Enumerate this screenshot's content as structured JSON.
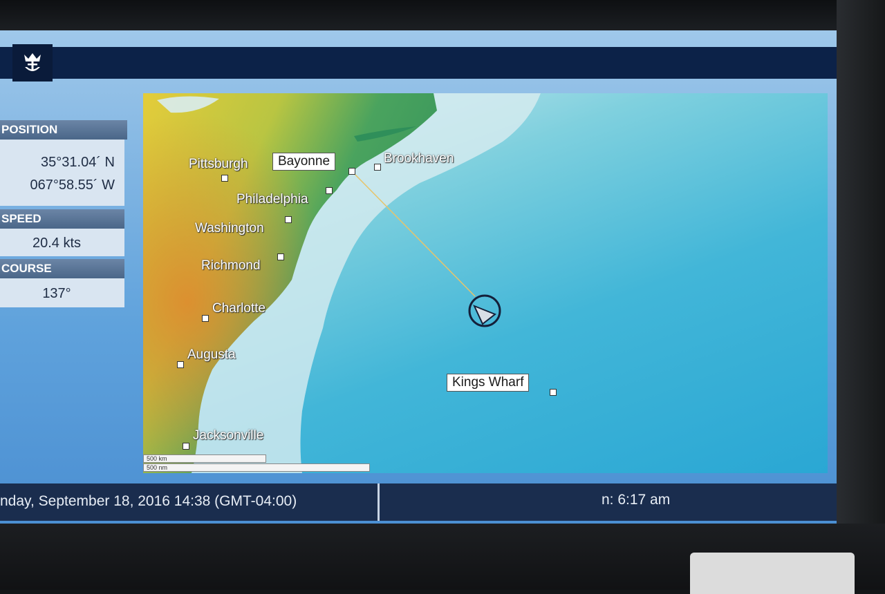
{
  "position": {
    "label": "POSITION",
    "latitude": "35°31.04´ N",
    "longitude": "067°58.55´ W"
  },
  "speed": {
    "label": "SPEED",
    "value": "20.4 kts"
  },
  "course": {
    "label": "COURSE",
    "value": "137°"
  },
  "map": {
    "cities": [
      {
        "name": "Pittsburgh",
        "style": "plain"
      },
      {
        "name": "Bayonne",
        "style": "boxed"
      },
      {
        "name": "Brookhaven",
        "style": "plain"
      },
      {
        "name": "Philadelphia",
        "style": "plain"
      },
      {
        "name": "Washington",
        "style": "plain"
      },
      {
        "name": "Richmond",
        "style": "plain"
      },
      {
        "name": "Charlotte",
        "style": "plain"
      },
      {
        "name": "Augusta",
        "style": "plain"
      },
      {
        "name": "Jacksonville",
        "style": "plain"
      },
      {
        "name": "Kings Wharf",
        "style": "boxed"
      }
    ],
    "scale_km": "500 km",
    "scale_nm": "500 nm",
    "colors": {
      "land_green": "#2f8f5a",
      "land_yellow": "#e4cc3a",
      "land_orange": "#e08a2e",
      "ocean": "#2aa7d4",
      "shelf": "#d8ecf0",
      "route_line": "#e8c46a"
    },
    "ship_icon": "ship-heading-icon"
  },
  "footer": {
    "datetime": "nday, September 18, 2016 14:38 (GMT-04:00)",
    "sunrise": "n: 6:17 am"
  },
  "branding": {
    "logo_icon": "crown-anchor-logo-icon"
  }
}
